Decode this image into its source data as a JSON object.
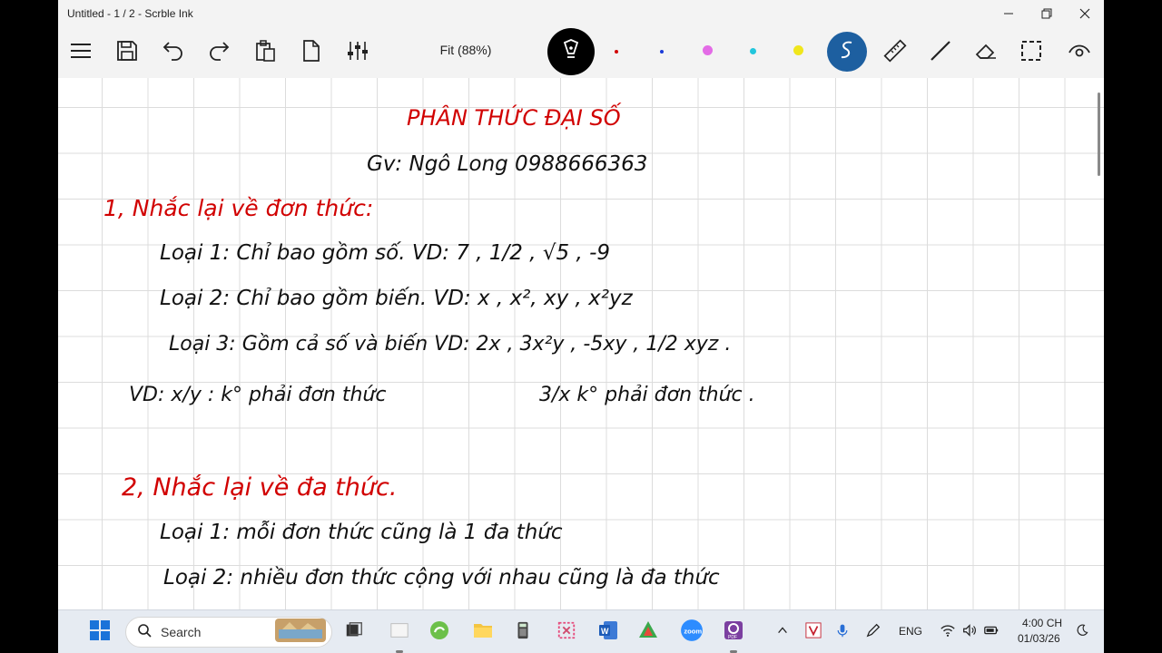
{
  "window": {
    "title": "Untitled - 1 / 2 - Scrble Ink"
  },
  "toolbar": {
    "zoom_label": "Fit (88%)",
    "pen_colors": [
      "#d10000",
      "#1a3ad8",
      "#e36be6",
      "#22c6dc",
      "#f0e61c"
    ]
  },
  "ink": {
    "heading": "PHÂN THỨC ĐẠI SỐ",
    "teacher": "Gv: Ngô Long 0988666363",
    "section1": "1, Nhắc lại về đơn thức:",
    "loai1": "Loại 1: Chỉ bao gồm số. VD: 7 , 1/2 , √5 , -9",
    "loai2": "Loại 2: Chỉ bao gồm biến. VD: x , x², xy , x²yz",
    "loai3": "Loại 3: Gồm cả số và biến VD: 2x , 3x²y , -5xy , 1/2 xyz .",
    "vd_not1": "VD: x/y : k° phải đơn thức",
    "vd_not2": "3/x k° phải đơn thức .",
    "section2": "2, Nhắc lại về đa thức.",
    "dloai1": "Loại 1: mỗi đơn thức cũng là 1 đa thức",
    "dloai2": "Loại 2: nhiều đơn thức cộng với nhau cũng là đa thức"
  },
  "taskbar": {
    "search_placeholder": "Search",
    "language": "ENG",
    "time": "4:00 CH",
    "date": "01/03/26"
  }
}
